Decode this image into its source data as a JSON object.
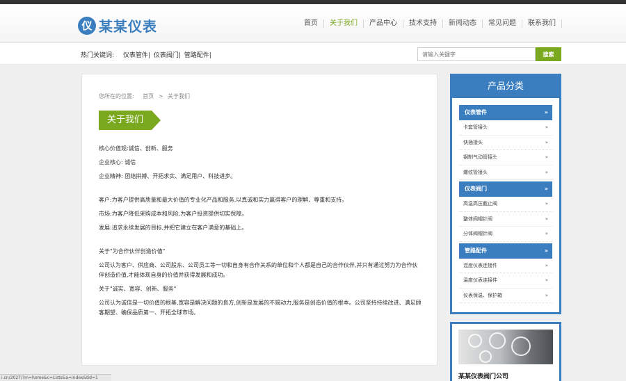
{
  "brand": {
    "logo_glyph": "仪",
    "name": "某某仪表"
  },
  "nav": [
    "首页",
    "关于我们",
    "产品中心",
    "技术支持",
    "新闻动态",
    "常见问题",
    "联系我们"
  ],
  "hot": {
    "label": "热门关键词:",
    "items": [
      "仪表管件|",
      "仪表阀门|",
      "管路配件|"
    ]
  },
  "search": {
    "placeholder": "请输入关键字",
    "button": "搜索"
  },
  "breadcrumb": {
    "prefix": "您所在的位置:",
    "home": "首页",
    "sep": ">",
    "current": "关于我们"
  },
  "page_title": "关于我们",
  "content": {
    "core_value": "核心价值观:诚信、创新、服务",
    "core": "企业核心: 诚信",
    "spirit": "企业精神: 团结拼搏、开拓求实、满足用户、科技进步。",
    "customer": "客户:为客户提供高质量和最大价值的专业化产品和服务,以真诚和实力赢得客户的理解、尊重和支持。",
    "market": "市场:为客户降低采购成本和风险,为客户投资提供切实保障。",
    "develop": "发展:追求永续发展的目标,并把它建立在客户满意的基础上。",
    "partner_title": "关于\"为合作伙伴创造价值\"",
    "partner_body": "公司认为客户、供应商、公司股东、公司员工等一切和自身有合作关系的单位和个人都是自己的合作伙伴,并只有通过努力为合作伙伴创造价值,才能体现自身的价值并获得发展和成功。",
    "honest_title": "关于\"诚实、宽容、创新、服务\"",
    "honest_body": "公司认为诚信是一切价值的根基,宽容是解决问题的良方,创新是发展的不竭动力,服务是创造价值的根本。公司坚持持续改进、满足顾客期望、确保品质第一、开拓全球市场。"
  },
  "sidebar": {
    "title": "产品分类",
    "categories": [
      {
        "title": "仪表管件",
        "items": [
          "卡套管接头",
          "快插接头",
          "钢制气动管接头",
          "螺纹管接头"
        ]
      },
      {
        "title": "仪表阀门",
        "items": [
          "高温高压截止阀",
          "整体阀帽针阀",
          "分体阀帽针阀"
        ]
      },
      {
        "title": "管路配件",
        "items": [
          "混度仪表连接件",
          "温度仪表连接件",
          "仪表保温、保护箱"
        ]
      }
    ]
  },
  "card": {
    "caption": "某某仪表阀门公司"
  },
  "status_url": "i.cn/2027/?m=home&c=Lists&a=index&tid=1",
  "colors": {
    "primary": "#3a7ec0",
    "accent": "#7aa920"
  }
}
